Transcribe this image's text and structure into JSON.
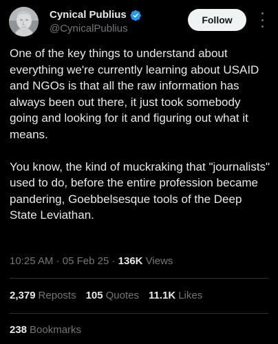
{
  "author": {
    "display_name": "Cynical Publius",
    "handle": "@CynicalPublius",
    "verified": true,
    "avatar_icon": "marble-bust-avatar"
  },
  "follow_label": "Follow",
  "more_icon": "more-vertical-icon",
  "tweet": {
    "text": "One of the key things to understand about everything we're currently learning about USAID and NGOs is that all the raw information has always been out there, it just took somebody going and looking for it and figuring out what it means.\n\nYou know, the kind of muckraking that \"journalists\" used to do, before the entire profession became pandering, Goebbelsesque tools of the Deep State Leviathan."
  },
  "meta": {
    "time": "10:25 AM",
    "separator": "·",
    "date": "05 Feb 25",
    "views_count": "136K",
    "views_label": "Views"
  },
  "stats": {
    "reposts_count": "2,379",
    "reposts_label": "Reposts",
    "quotes_count": "105",
    "quotes_label": "Quotes",
    "likes_count": "11.1K",
    "likes_label": "Likes",
    "bookmarks_count": "238",
    "bookmarks_label": "Bookmarks"
  },
  "colors": {
    "background": "#000000",
    "primary_text": "#e7e9ea",
    "secondary_text": "#71767b",
    "verified_blue": "#1d9bf0",
    "divider": "#2f3336",
    "follow_button_bg": "#eff3f4"
  }
}
